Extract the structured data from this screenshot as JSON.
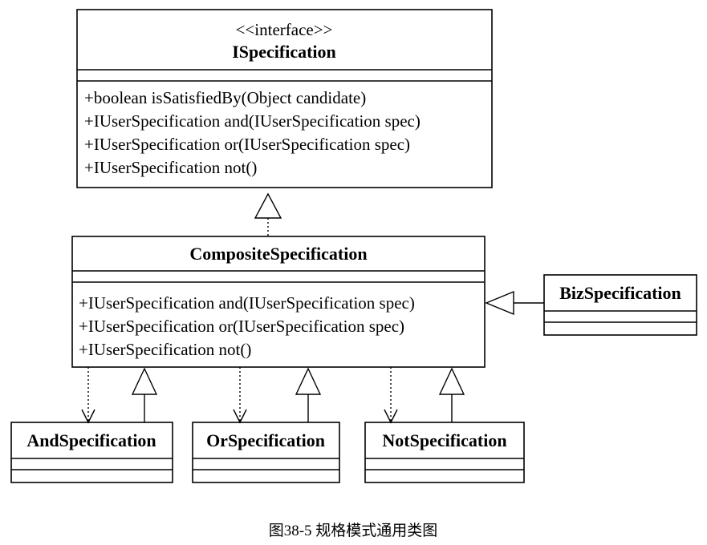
{
  "ispecification": {
    "stereotype": "<<interface>>",
    "name": "ISpecification",
    "methods": [
      "+boolean isSatisfiedBy(Object candidate)",
      "+IUserSpecification and(IUserSpecification spec)",
      "+IUserSpecification or(IUserSpecification spec)",
      "+IUserSpecification not()"
    ]
  },
  "composite": {
    "name": "CompositeSpecification",
    "methods": [
      "+IUserSpecification and(IUserSpecification spec)",
      "+IUserSpecification or(IUserSpecification spec)",
      "+IUserSpecification not()"
    ]
  },
  "biz": {
    "name": "BizSpecification"
  },
  "and_spec": {
    "name": "AndSpecification"
  },
  "or_spec": {
    "name": "OrSpecification"
  },
  "not_spec": {
    "name": "NotSpecification"
  },
  "caption": "图38-5 规格模式通用类图"
}
